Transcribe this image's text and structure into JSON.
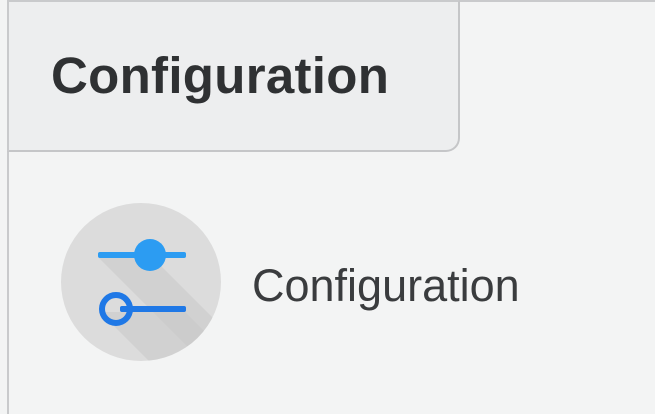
{
  "tab": {
    "label": "Configuration"
  },
  "item": {
    "label": "Configuration",
    "icon": "sliders-icon"
  },
  "colors": {
    "accent": "#2c8ff0",
    "accent_dark": "#1a73e8",
    "icon_bg": "#dcdcdc",
    "text": "#2f3133"
  }
}
